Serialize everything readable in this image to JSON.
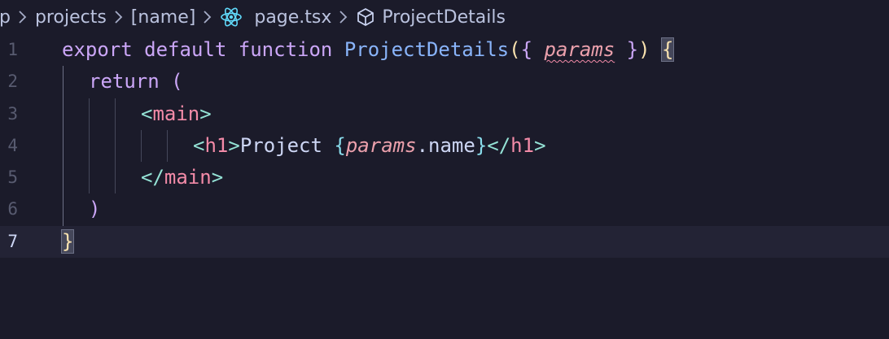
{
  "breadcrumb": {
    "items": [
      {
        "label": "p",
        "icon": null
      },
      {
        "label": "projects",
        "icon": null
      },
      {
        "label": "[name]",
        "icon": null
      },
      {
        "label": "page.tsx",
        "icon": "react-icon"
      },
      {
        "label": "ProjectDetails",
        "icon": "cube-icon"
      }
    ]
  },
  "editor": {
    "current_line": 7,
    "lines": [
      {
        "number": "1",
        "tokens": [
          "export",
          "default",
          "function",
          "ProjectDetails",
          "(",
          "{",
          "params",
          "}",
          ")",
          "{"
        ]
      },
      {
        "number": "2",
        "tokens": [
          "return",
          "("
        ]
      },
      {
        "number": "3",
        "tokens": [
          "<",
          "main",
          ">"
        ]
      },
      {
        "number": "4",
        "tokens": [
          "<",
          "h1",
          ">",
          "Project ",
          "{",
          "params",
          ".",
          "name",
          "}",
          "</",
          "h1",
          ">"
        ]
      },
      {
        "number": "5",
        "tokens": [
          "</",
          "main",
          ">"
        ]
      },
      {
        "number": "6",
        "tokens": [
          ")"
        ]
      },
      {
        "number": "7",
        "tokens": [
          "}"
        ]
      }
    ]
  },
  "colors": {
    "background": "#1b1b2a",
    "keyword": "#cba6f7",
    "function": "#89b4fa",
    "tag": "#f38ba8",
    "param": "#eba0ac",
    "brace": "#f9e2af"
  }
}
